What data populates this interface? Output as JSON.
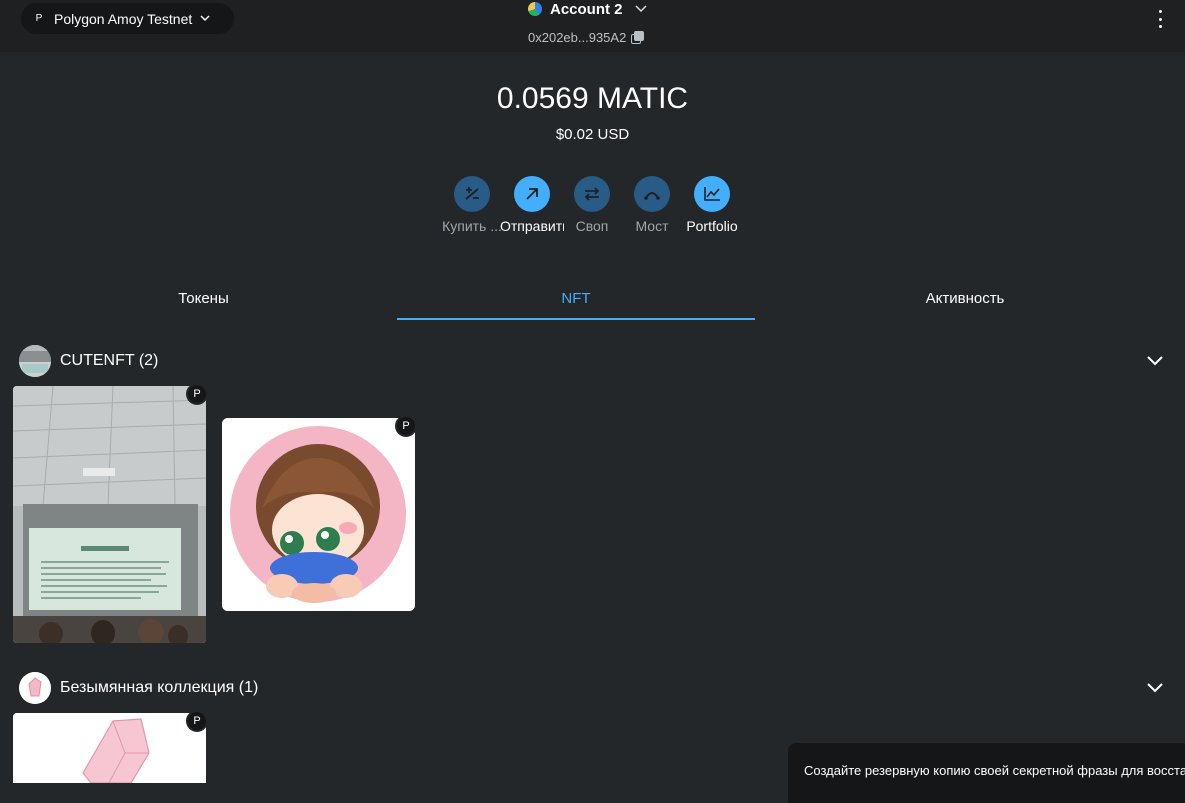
{
  "header": {
    "network_badge": "P",
    "network_name": "Polygon Amoy Testnet",
    "account_name": "Account 2",
    "account_address": "0x202eb...935A2"
  },
  "balance": {
    "amount": "0.0569 MATIC",
    "fiat": "$0.02 USD"
  },
  "actions": [
    {
      "label": "Купить ...",
      "icon": "plus-minus-icon",
      "enabled": false
    },
    {
      "label": "Отправить",
      "icon": "arrow-up-right-icon",
      "enabled": true
    },
    {
      "label": "Своп",
      "icon": "swap-icon",
      "enabled": false
    },
    {
      "label": "Мост",
      "icon": "bridge-icon",
      "enabled": false
    },
    {
      "label": "Portfolio",
      "icon": "chart-icon",
      "enabled": true
    }
  ],
  "tabs": [
    {
      "label": "Токены",
      "selected": false
    },
    {
      "label": "NFT",
      "selected": true
    },
    {
      "label": "Активность",
      "selected": false
    }
  ],
  "collections": [
    {
      "name": "CUTENFT (2)",
      "items": [
        "P",
        "P"
      ]
    },
    {
      "name": "Безымянная коллекция (1)",
      "items": [
        "P"
      ]
    }
  ],
  "toast": {
    "text": "Создайте резервную копию своей секретной фразы для восстан"
  },
  "colors": {
    "accent": "#43aefc",
    "background": "#24272a",
    "topbar": "#1e2022"
  }
}
